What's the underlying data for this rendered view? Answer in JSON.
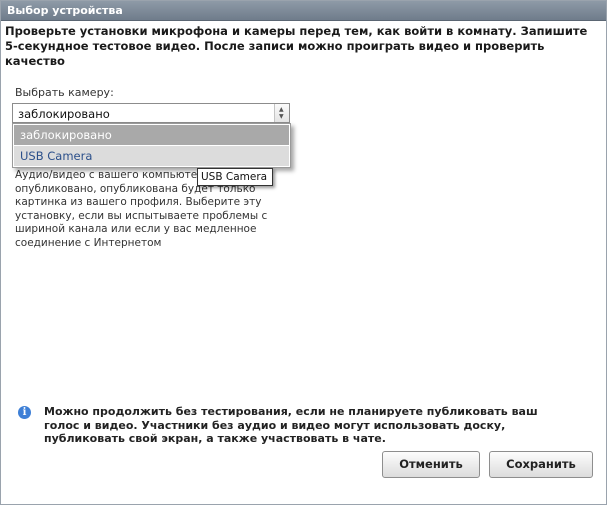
{
  "window": {
    "title": "Выбор устройства"
  },
  "intro": "Проверьте установки микрофона и камеры перед тем, как войти в комнату. Запишите 5-секундное тестовое видео. После записи можно проиграть видео и проверить качество",
  "camera": {
    "label": "Выбрать камеру:",
    "selected": "заблокировано",
    "options": [
      "заблокировано",
      "USB Camera"
    ]
  },
  "tooltip": "USB Camera",
  "description": "Аудио/видео с вашего компьютера не будет опубликовано, опубликована будет только картинка из вашего профиля. Выберите эту установку, если вы испытываете проблемы с шириной канала или если у вас медленное соединение с Интернетом",
  "info": {
    "icon": "info-icon",
    "text": "Можно продолжить без тестирования, если не планируете публиковать ваш голос и видео. Участники без аудио и видео могут использовать доску, публиковать свой экран, а также участвовать в чате."
  },
  "buttons": {
    "cancel": "Отменить",
    "save": "Сохранить"
  }
}
